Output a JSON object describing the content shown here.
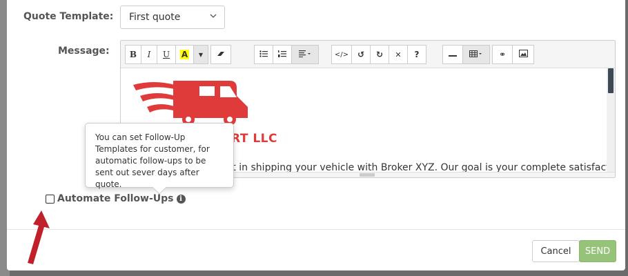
{
  "form": {
    "quote_template_label": "Quote Template:",
    "quote_template_value": "First quote",
    "message_label": "Message:"
  },
  "toolbar": {
    "buttons": {
      "bold": "B",
      "italic": "I",
      "underline": "U",
      "highlight": "A",
      "help": "?"
    }
  },
  "editor": {
    "company_partial": "RT LLC",
    "body_partial": "rest in shipping your vehicle with Broker XYZ. Our goal is your complete satisfaction."
  },
  "tooltip": {
    "text": "You can set Follow-Up Templates for customer, for automatic follow-ups to be sent out sever days after quote."
  },
  "followup": {
    "label": "Automate Follow-Ups",
    "checked": false
  },
  "footer": {
    "cancel_label": "Cancel",
    "send_label": "SEND"
  },
  "colors": {
    "brand_red": "#e03b3b",
    "send_green": "#96c27a",
    "annotation_arrow": "#c0202a"
  },
  "icons": [
    "chevron-down-icon",
    "dropdown-caret-icon",
    "eraser-icon",
    "unordered-list-icon",
    "ordered-list-icon",
    "align-icon",
    "code-view-icon",
    "undo-icon",
    "redo-icon",
    "fullscreen-icon",
    "horizontal-rule-icon",
    "table-icon",
    "link-icon",
    "image-icon",
    "info-icon",
    "truck-logo-icon",
    "red-arrow-icon"
  ]
}
